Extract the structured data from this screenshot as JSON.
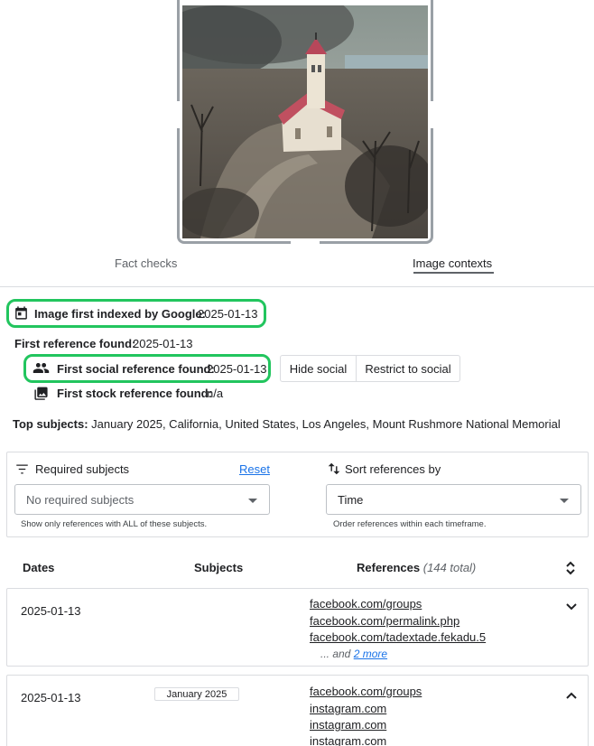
{
  "tabs": [
    {
      "label": "Fact checks",
      "active": false
    },
    {
      "label": "Image contexts",
      "active": true
    }
  ],
  "first_indexed": {
    "label": "Image first indexed by Google:",
    "value": "2025-01-13"
  },
  "first_reference": {
    "label": "First reference found:",
    "value": "2025-01-13"
  },
  "first_social": {
    "label": "First social reference found:",
    "value": "2025-01-13"
  },
  "first_stock": {
    "label": "First stock reference found:",
    "value": "n/a"
  },
  "buttons": {
    "hide_social": "Hide social",
    "restrict_social": "Restrict to social"
  },
  "top_subjects": {
    "label": "Top subjects:",
    "value": "January 2025, California, United States, Los Angeles, Mount Rushmore National Memorial"
  },
  "filters": {
    "required_subjects": {
      "label": "Required subjects",
      "reset": "Reset",
      "placeholder": "No required subjects",
      "hint": "Show only references with ALL of these subjects."
    },
    "sort": {
      "label": "Sort references by",
      "value": "Time",
      "hint": "Order references within each timeframe."
    }
  },
  "table": {
    "headers": {
      "dates": "Dates",
      "subjects": "Subjects",
      "references": "References",
      "total": "(144 total)"
    },
    "rows": [
      {
        "date": "2025-01-13",
        "subjects": [],
        "links": [
          "facebook.com/groups",
          "facebook.com/permalink.php",
          "facebook.com/tadextade.fekadu.5"
        ],
        "more_prefix": "... and",
        "more_link": "2 more",
        "expanded": false
      },
      {
        "date": "2025-01-13",
        "subjects": [
          "January 2025"
        ],
        "links": [
          "facebook.com/groups",
          "instagram.com",
          "instagram.com",
          "instagram.com"
        ],
        "expanded": true
      }
    ]
  },
  "colors": {
    "highlight": "#22c55e",
    "link_blue": "#1a73e8",
    "border": "#dadce0"
  },
  "icons": [
    "calendar-icon",
    "people-icon",
    "image-icon",
    "filter-icon",
    "sort-icon",
    "unfold-icon",
    "chevron-down-icon",
    "chevron-up-icon"
  ]
}
